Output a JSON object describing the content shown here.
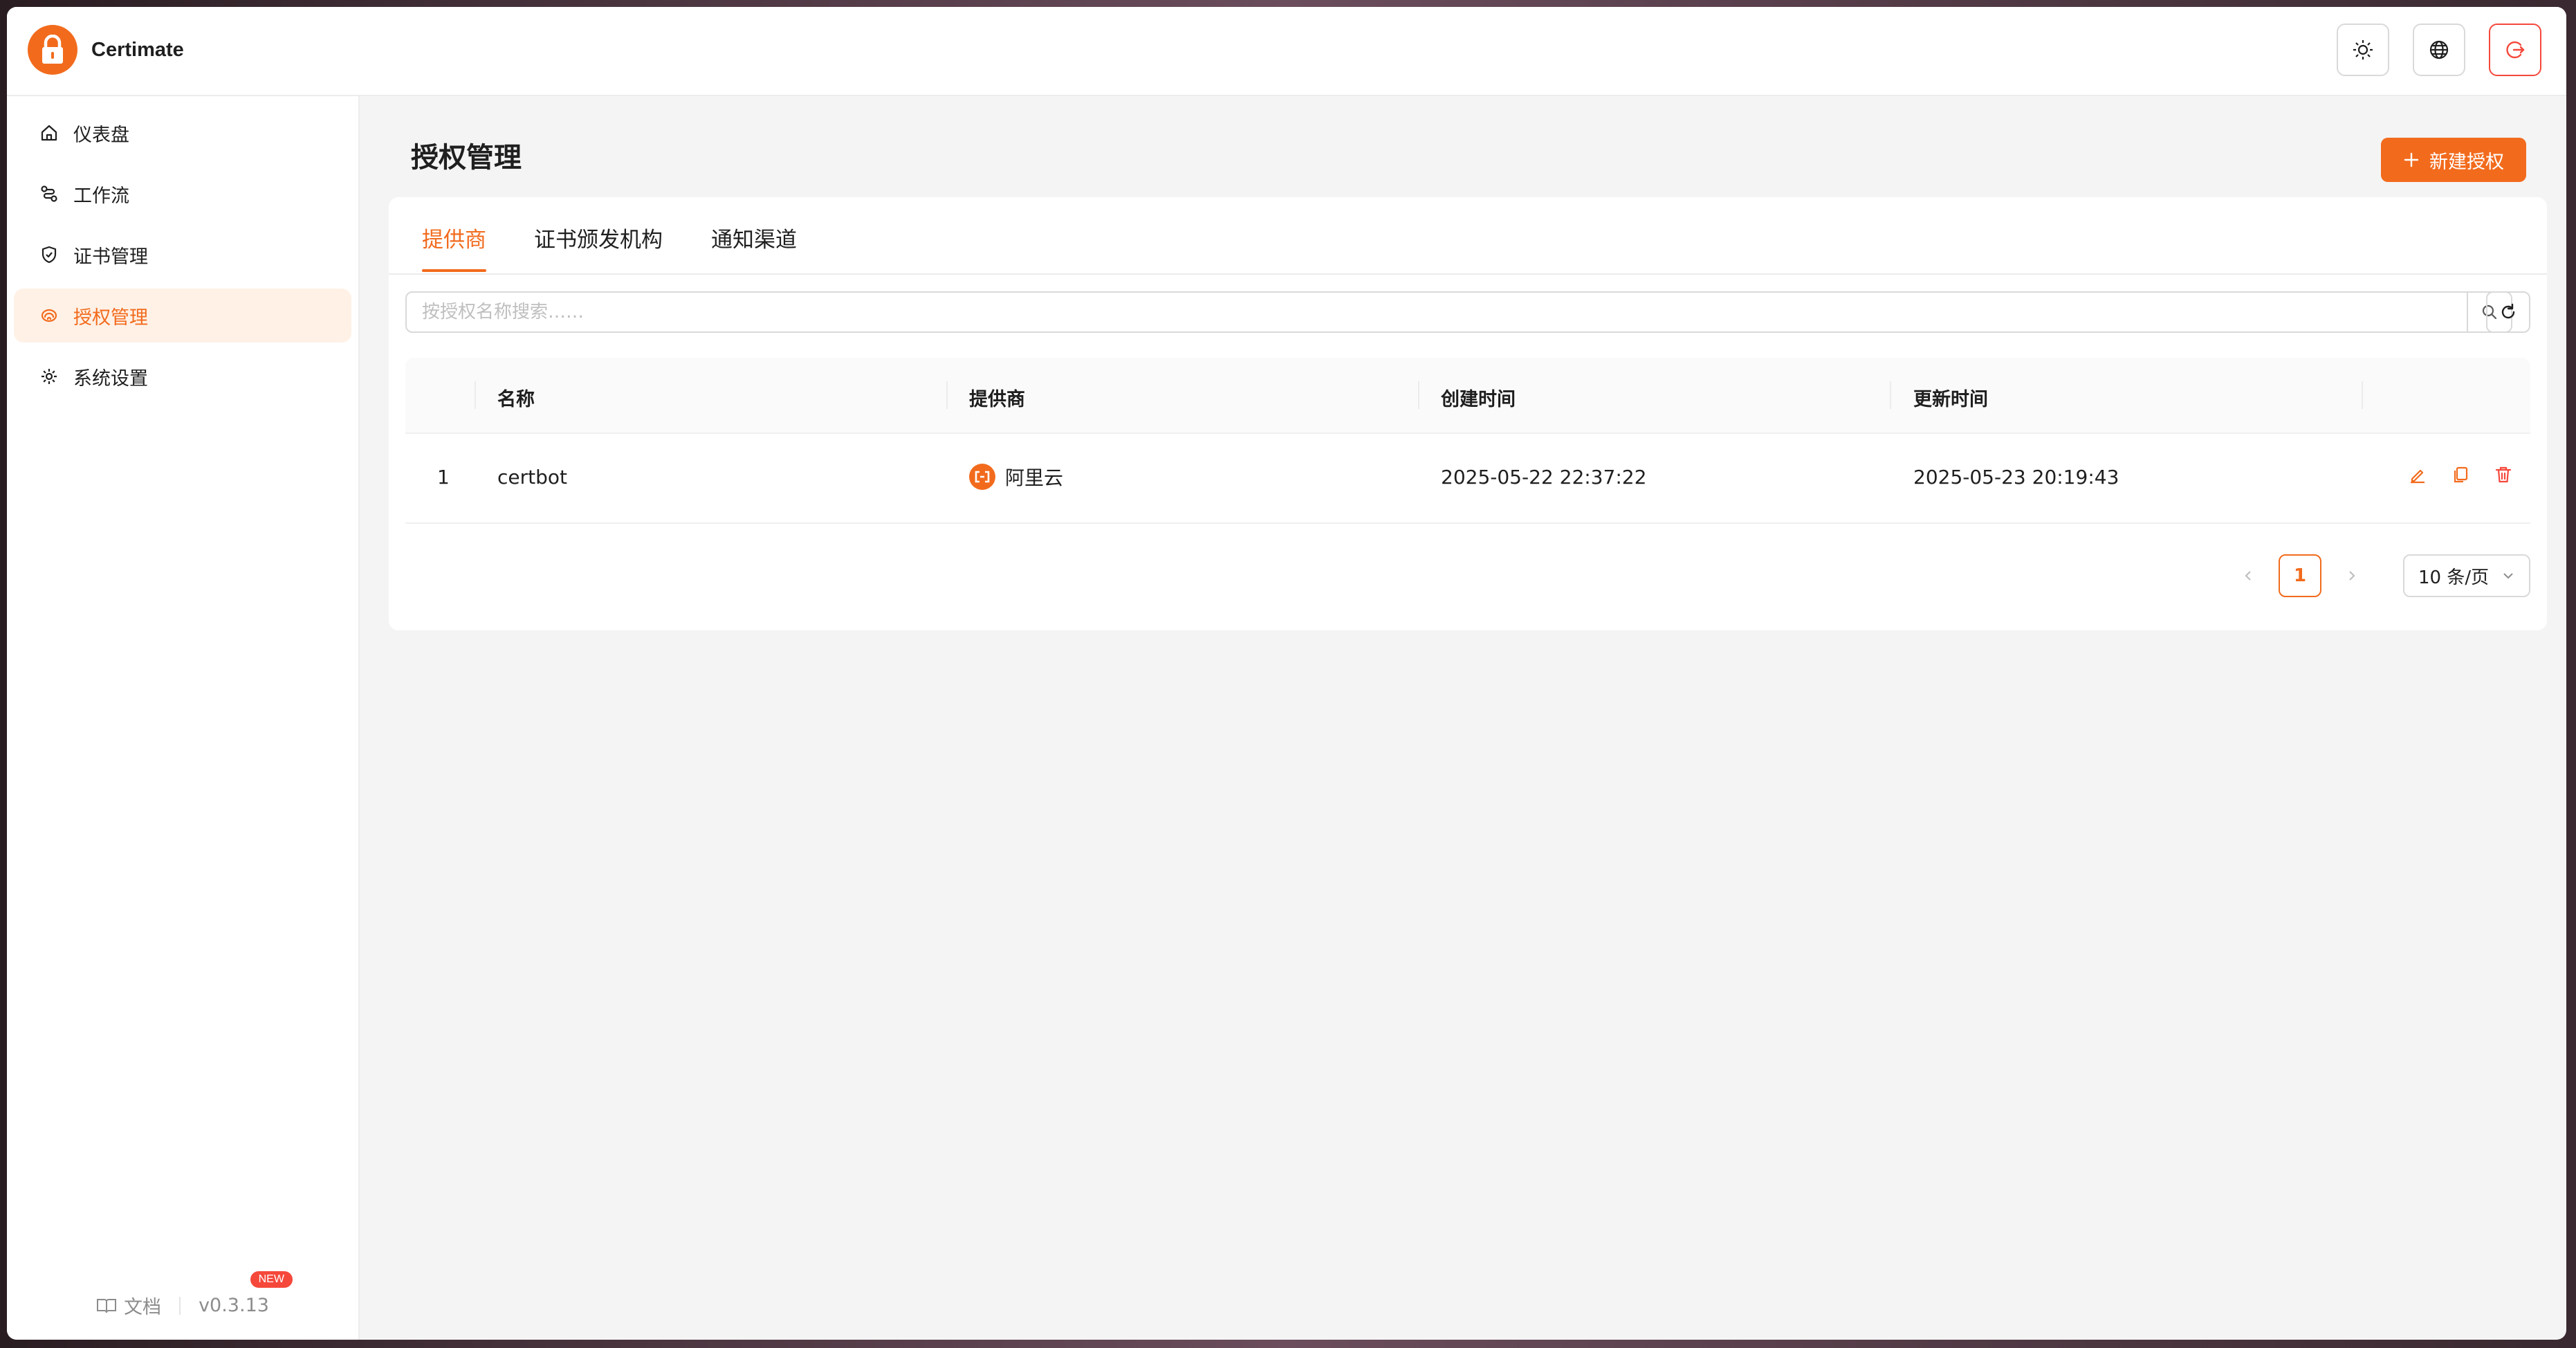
{
  "app": {
    "name": "Certimate",
    "version": "v0.3.13",
    "version_badge": "NEW",
    "docs_label": "文档"
  },
  "topbar": {
    "buttons": [
      {
        "icon": "sun-icon"
      },
      {
        "icon": "globe-icon"
      },
      {
        "icon": "logout-icon"
      }
    ]
  },
  "sidebar": {
    "items": [
      {
        "label": "仪表盘",
        "icon": "home-icon",
        "active": false
      },
      {
        "label": "工作流",
        "icon": "workflow-icon",
        "active": false
      },
      {
        "label": "证书管理",
        "icon": "shield-icon",
        "active": false
      },
      {
        "label": "授权管理",
        "icon": "fingerprint-icon",
        "active": true
      },
      {
        "label": "系统设置",
        "icon": "gear-icon",
        "active": false
      }
    ]
  },
  "page": {
    "title": "授权管理",
    "add_button": "新建授权"
  },
  "tabs": [
    {
      "label": "提供商",
      "active": true
    },
    {
      "label": "证书颁发机构",
      "active": false
    },
    {
      "label": "通知渠道",
      "active": false
    }
  ],
  "search": {
    "placeholder": "按授权名称搜索……",
    "value": ""
  },
  "table": {
    "columns": [
      "名称",
      "提供商",
      "创建时间",
      "更新时间"
    ],
    "rows": [
      {
        "index": "1",
        "name": "certbot",
        "provider": "阿里云",
        "created": "2025-05-22 22:37:22",
        "updated": "2025-05-23 20:19:43"
      }
    ]
  },
  "pagination": {
    "current": "1",
    "page_size": "10 条/页"
  },
  "colors": {
    "accent": "#f26b1d",
    "danger": "#f5483b"
  }
}
